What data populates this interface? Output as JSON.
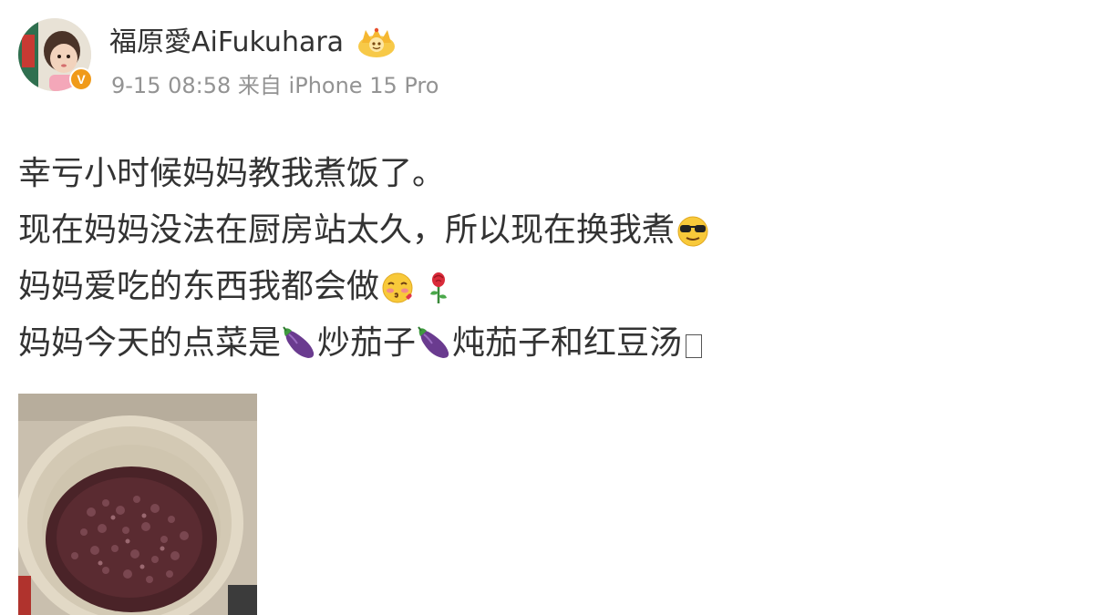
{
  "post": {
    "author": {
      "name": "福原愛AiFukuhara",
      "avatar": "avatar",
      "badge_icon": "verified-badge-icon",
      "member_icon": "crown-member-icon",
      "badge_text": "V"
    },
    "meta": {
      "time": "9-15 08:58",
      "source_prefix": "来自",
      "device": "iPhone 15 Pro"
    },
    "lines": {
      "l1": "幸亏小时候妈妈教我煮饭了。",
      "l2": "现在妈妈没法在厨房站太久，所以现在换我煮",
      "l3": "妈妈爱吃的东西我都会做",
      "l4a": "妈妈今天的点菜是",
      "l4b": "炒茄子",
      "l4c": "炖茄子和红豆汤"
    },
    "emojis": {
      "sunglasses": "sunglasses-emoji-icon",
      "kiss": "kiss-emoji-icon",
      "rose": "rose-emoji-icon",
      "eggplant": "eggplant-emoji-icon",
      "unknown": "missing-glyph-box"
    },
    "image": "red-bean-soup-photo"
  },
  "colors": {
    "text": "#333333",
    "meta": "#939393",
    "badge": "#f09a1a",
    "eggplant": "#6a3b8f",
    "soup": "#4a2328"
  }
}
